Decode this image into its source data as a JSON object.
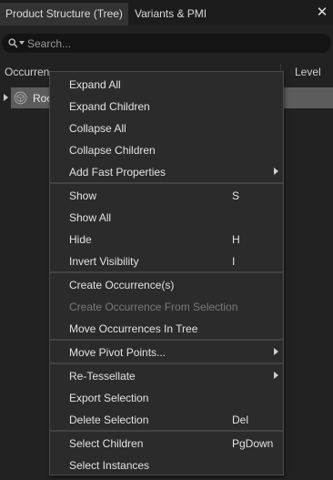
{
  "tabs": [
    {
      "label": "Product Structure (Tree)",
      "active": true
    },
    {
      "label": "Variants & PMI",
      "active": false
    }
  ],
  "close_glyph": "✕",
  "search": {
    "placeholder": "Search...",
    "value": "",
    "icon": "search-icon"
  },
  "columns": {
    "occurrence": "Occurren",
    "level": "Level"
  },
  "tree": {
    "row_label": "Roo",
    "row_icon": "cube-icon"
  },
  "menu": {
    "groups": [
      [
        {
          "label": "Expand All",
          "shortcut": "",
          "submenu": false,
          "disabled": false
        },
        {
          "label": "Expand Children",
          "shortcut": "",
          "submenu": false,
          "disabled": false
        },
        {
          "label": "Collapse All",
          "shortcut": "",
          "submenu": false,
          "disabled": false
        },
        {
          "label": "Collapse Children",
          "shortcut": "",
          "submenu": false,
          "disabled": false
        },
        {
          "label": "Add Fast Properties",
          "shortcut": "",
          "submenu": true,
          "disabled": false
        }
      ],
      [
        {
          "label": "Show",
          "shortcut": "S",
          "submenu": false,
          "disabled": false
        },
        {
          "label": "Show All",
          "shortcut": "",
          "submenu": false,
          "disabled": false
        },
        {
          "label": "Hide",
          "shortcut": "H",
          "submenu": false,
          "disabled": false
        },
        {
          "label": "Invert Visibility",
          "shortcut": "I",
          "submenu": false,
          "disabled": false
        }
      ],
      [
        {
          "label": "Create Occurrence(s)",
          "shortcut": "",
          "submenu": false,
          "disabled": false
        },
        {
          "label": "Create Occurrence From Selection",
          "shortcut": "",
          "submenu": false,
          "disabled": true
        },
        {
          "label": "Move Occurrences In Tree",
          "shortcut": "",
          "submenu": false,
          "disabled": false
        }
      ],
      [
        {
          "label": "Move Pivot Points...",
          "shortcut": "",
          "submenu": true,
          "disabled": false
        }
      ],
      [
        {
          "label": "Re-Tessellate",
          "shortcut": "",
          "submenu": true,
          "disabled": false
        },
        {
          "label": "Export Selection",
          "shortcut": "",
          "submenu": false,
          "disabled": false
        },
        {
          "label": "Delete Selection",
          "shortcut": "Del",
          "submenu": false,
          "disabled": false
        }
      ],
      [
        {
          "label": "Select Children",
          "shortcut": "PgDown",
          "submenu": false,
          "disabled": false
        },
        {
          "label": "Select Instances",
          "shortcut": "",
          "submenu": false,
          "disabled": false
        }
      ]
    ]
  },
  "colors": {
    "background": "#222222",
    "menu_bg": "#2b2b2b",
    "selected_row": "#5c5c5c",
    "disabled_text": "#7a7a7a"
  }
}
